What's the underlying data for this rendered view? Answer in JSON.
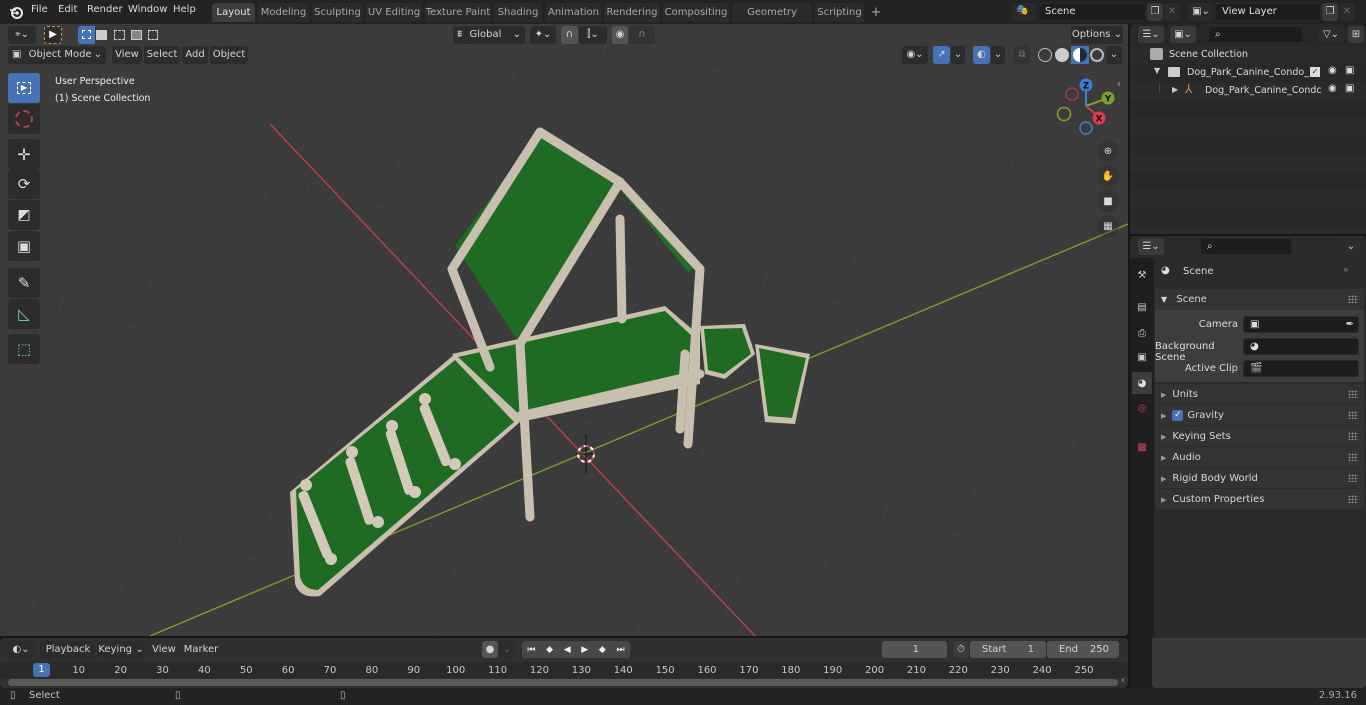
{
  "app": {
    "name": "Blender",
    "version": "2.93.16"
  },
  "menu": [
    "File",
    "Edit",
    "Render",
    "Window",
    "Help"
  ],
  "workspaces": [
    {
      "label": "Layout",
      "active": true
    },
    {
      "label": "Modeling"
    },
    {
      "label": "Sculpting"
    },
    {
      "label": "UV Editing"
    },
    {
      "label": "Texture Paint"
    },
    {
      "label": "Shading"
    },
    {
      "label": "Animation"
    },
    {
      "label": "Rendering"
    },
    {
      "label": "Compositing"
    },
    {
      "label": "Geometry Nodes"
    },
    {
      "label": "Scripting"
    }
  ],
  "add_workspace": "+",
  "scene_selector": {
    "value": "Scene"
  },
  "view_layer_selector": {
    "value": "View Layer"
  },
  "viewport": {
    "mode": "Object Mode",
    "menus": [
      "View",
      "Select",
      "Add",
      "Object"
    ],
    "transform_orientation": "Global",
    "options_label": "Options",
    "overlay_text": [
      "User Perspective",
      "(1) Scene Collection"
    ],
    "gizmo_axes": {
      "x": "X",
      "y": "Y",
      "z": "Z"
    },
    "colors": {
      "x_axis": "#c8404e",
      "y_axis": "#7ea32a",
      "z_axis": "#3c7fd1",
      "model_green": "#1f6b23",
      "model_frame": "#c9bfae",
      "select_blue": "#4772b3"
    },
    "tools": [
      "select-box",
      "cursor",
      "move",
      "rotate",
      "scale",
      "transform",
      "annotate",
      "measure",
      "add-cube"
    ],
    "nav_buttons": [
      "zoom",
      "pan",
      "camera-view",
      "ortho-toggle"
    ]
  },
  "outliner": {
    "root": "Scene Collection",
    "items": [
      {
        "label": "Dog_Park_Canine_Condo_Gre",
        "type": "collection",
        "checked": true
      },
      {
        "label": "Dog_Park_Canine_Condc",
        "type": "empty"
      }
    ]
  },
  "properties": {
    "context_title": "Scene",
    "section": "Scene",
    "fields": [
      {
        "label": "Camera",
        "value": ""
      },
      {
        "label": "Background Scene",
        "value": ""
      },
      {
        "label": "Active Clip",
        "value": ""
      }
    ],
    "panels": [
      {
        "label": "Units"
      },
      {
        "label": "Gravity",
        "checkbox": true
      },
      {
        "label": "Keying Sets"
      },
      {
        "label": "Audio"
      },
      {
        "label": "Rigid Body World"
      },
      {
        "label": "Custom Properties"
      }
    ],
    "tabs": [
      "tool",
      "render",
      "output",
      "view-layer",
      "scene",
      "world",
      "texture"
    ]
  },
  "timeline": {
    "menus": [
      "Playback",
      "Keying",
      "View",
      "Marker"
    ],
    "current_frame": "1",
    "start_label": "Start",
    "start": "1",
    "end_label": "End",
    "end": "250",
    "ticks": [
      "1",
      "10",
      "20",
      "30",
      "40",
      "50",
      "60",
      "70",
      "80",
      "90",
      "100",
      "110",
      "120",
      "130",
      "140",
      "150",
      "160",
      "170",
      "180",
      "190",
      "200",
      "210",
      "220",
      "230",
      "240",
      "250"
    ]
  },
  "statusbar": {
    "left": "Select",
    "version": "2.93.16"
  }
}
